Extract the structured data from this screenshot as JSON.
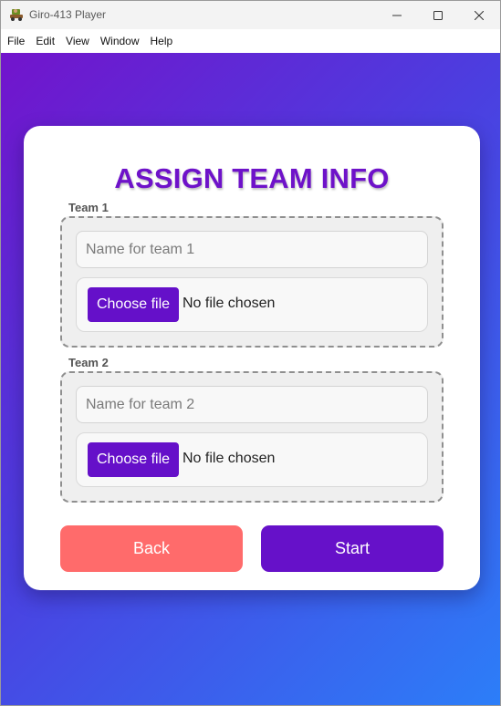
{
  "window": {
    "title": "Giro-413 Player",
    "app_icon": "cart-racer-icon"
  },
  "menubar": {
    "items": [
      {
        "label": "File"
      },
      {
        "label": "Edit"
      },
      {
        "label": "View"
      },
      {
        "label": "Window"
      },
      {
        "label": "Help"
      }
    ]
  },
  "theme": {
    "gradient_start": "#7214cc",
    "gradient_end": "#2c7ef8",
    "accent": "#6611c9",
    "back_button_color": "#ff6b6b"
  },
  "form": {
    "title": "ASSIGN TEAM INFO",
    "teams": [
      {
        "label": "Team 1",
        "name_placeholder": "Name for team 1",
        "name_value": "",
        "file_button_label": "Choose file",
        "file_status": "No file chosen"
      },
      {
        "label": "Team 2",
        "name_placeholder": "Name for team 2",
        "name_value": "",
        "file_button_label": "Choose file",
        "file_status": "No file chosen"
      }
    ],
    "back_label": "Back",
    "start_label": "Start"
  }
}
